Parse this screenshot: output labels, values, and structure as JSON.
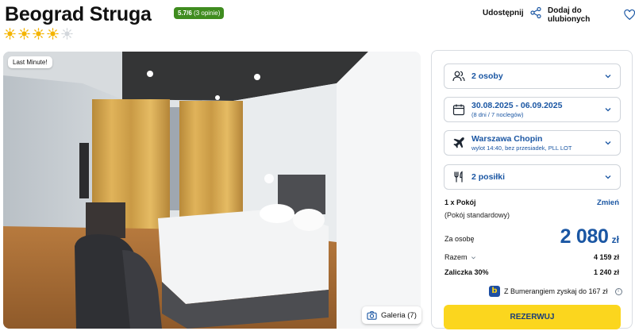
{
  "hotel": {
    "name": "Beograd Struga",
    "rating_score": "5.7/6",
    "rating_count": "(3 opinie)",
    "stars": 4,
    "stars_max": 5
  },
  "actions": {
    "share_label": "Udostępnij",
    "favorite_label": "Dodaj do ulubionych"
  },
  "gallery": {
    "badge": "Last Minute!",
    "button_label": "Galeria (7)"
  },
  "booking": {
    "people": {
      "main": "2 osoby",
      "icon": "people-icon"
    },
    "dates": {
      "main": "30.08.2025 - 06.09.2025",
      "sub": "(8 dni / 7 noclegów)",
      "icon": "calendar-icon"
    },
    "flight": {
      "main": "Warszawa Chopin",
      "sub": "wylot 14:40, bez przesiadek, PLL LOT",
      "icon": "plane-icon"
    },
    "meals": {
      "main": "2 posiłki",
      "icon": "cutlery-icon"
    },
    "room_line": "1 x Pokój",
    "room_type": "(Pokój standardowy)",
    "change_label": "Zmień",
    "per_person_label": "Za osobę",
    "per_person_value": "2 080",
    "currency": "zł",
    "total_label": "Razem",
    "total_value": "4 159 zł",
    "deposit_label": "Zaliczka 30%",
    "deposit_value": "1 240 zł",
    "bumerang_text": "Z Bumerangiem zyskaj do 167 zł",
    "reserve_label": "REZERWUJ"
  },
  "colors": {
    "accent_blue": "#1a56a3",
    "rating_green": "#3f8c1f",
    "star_yellow": "#f4b400",
    "reserve_yellow": "#fbd61e"
  }
}
